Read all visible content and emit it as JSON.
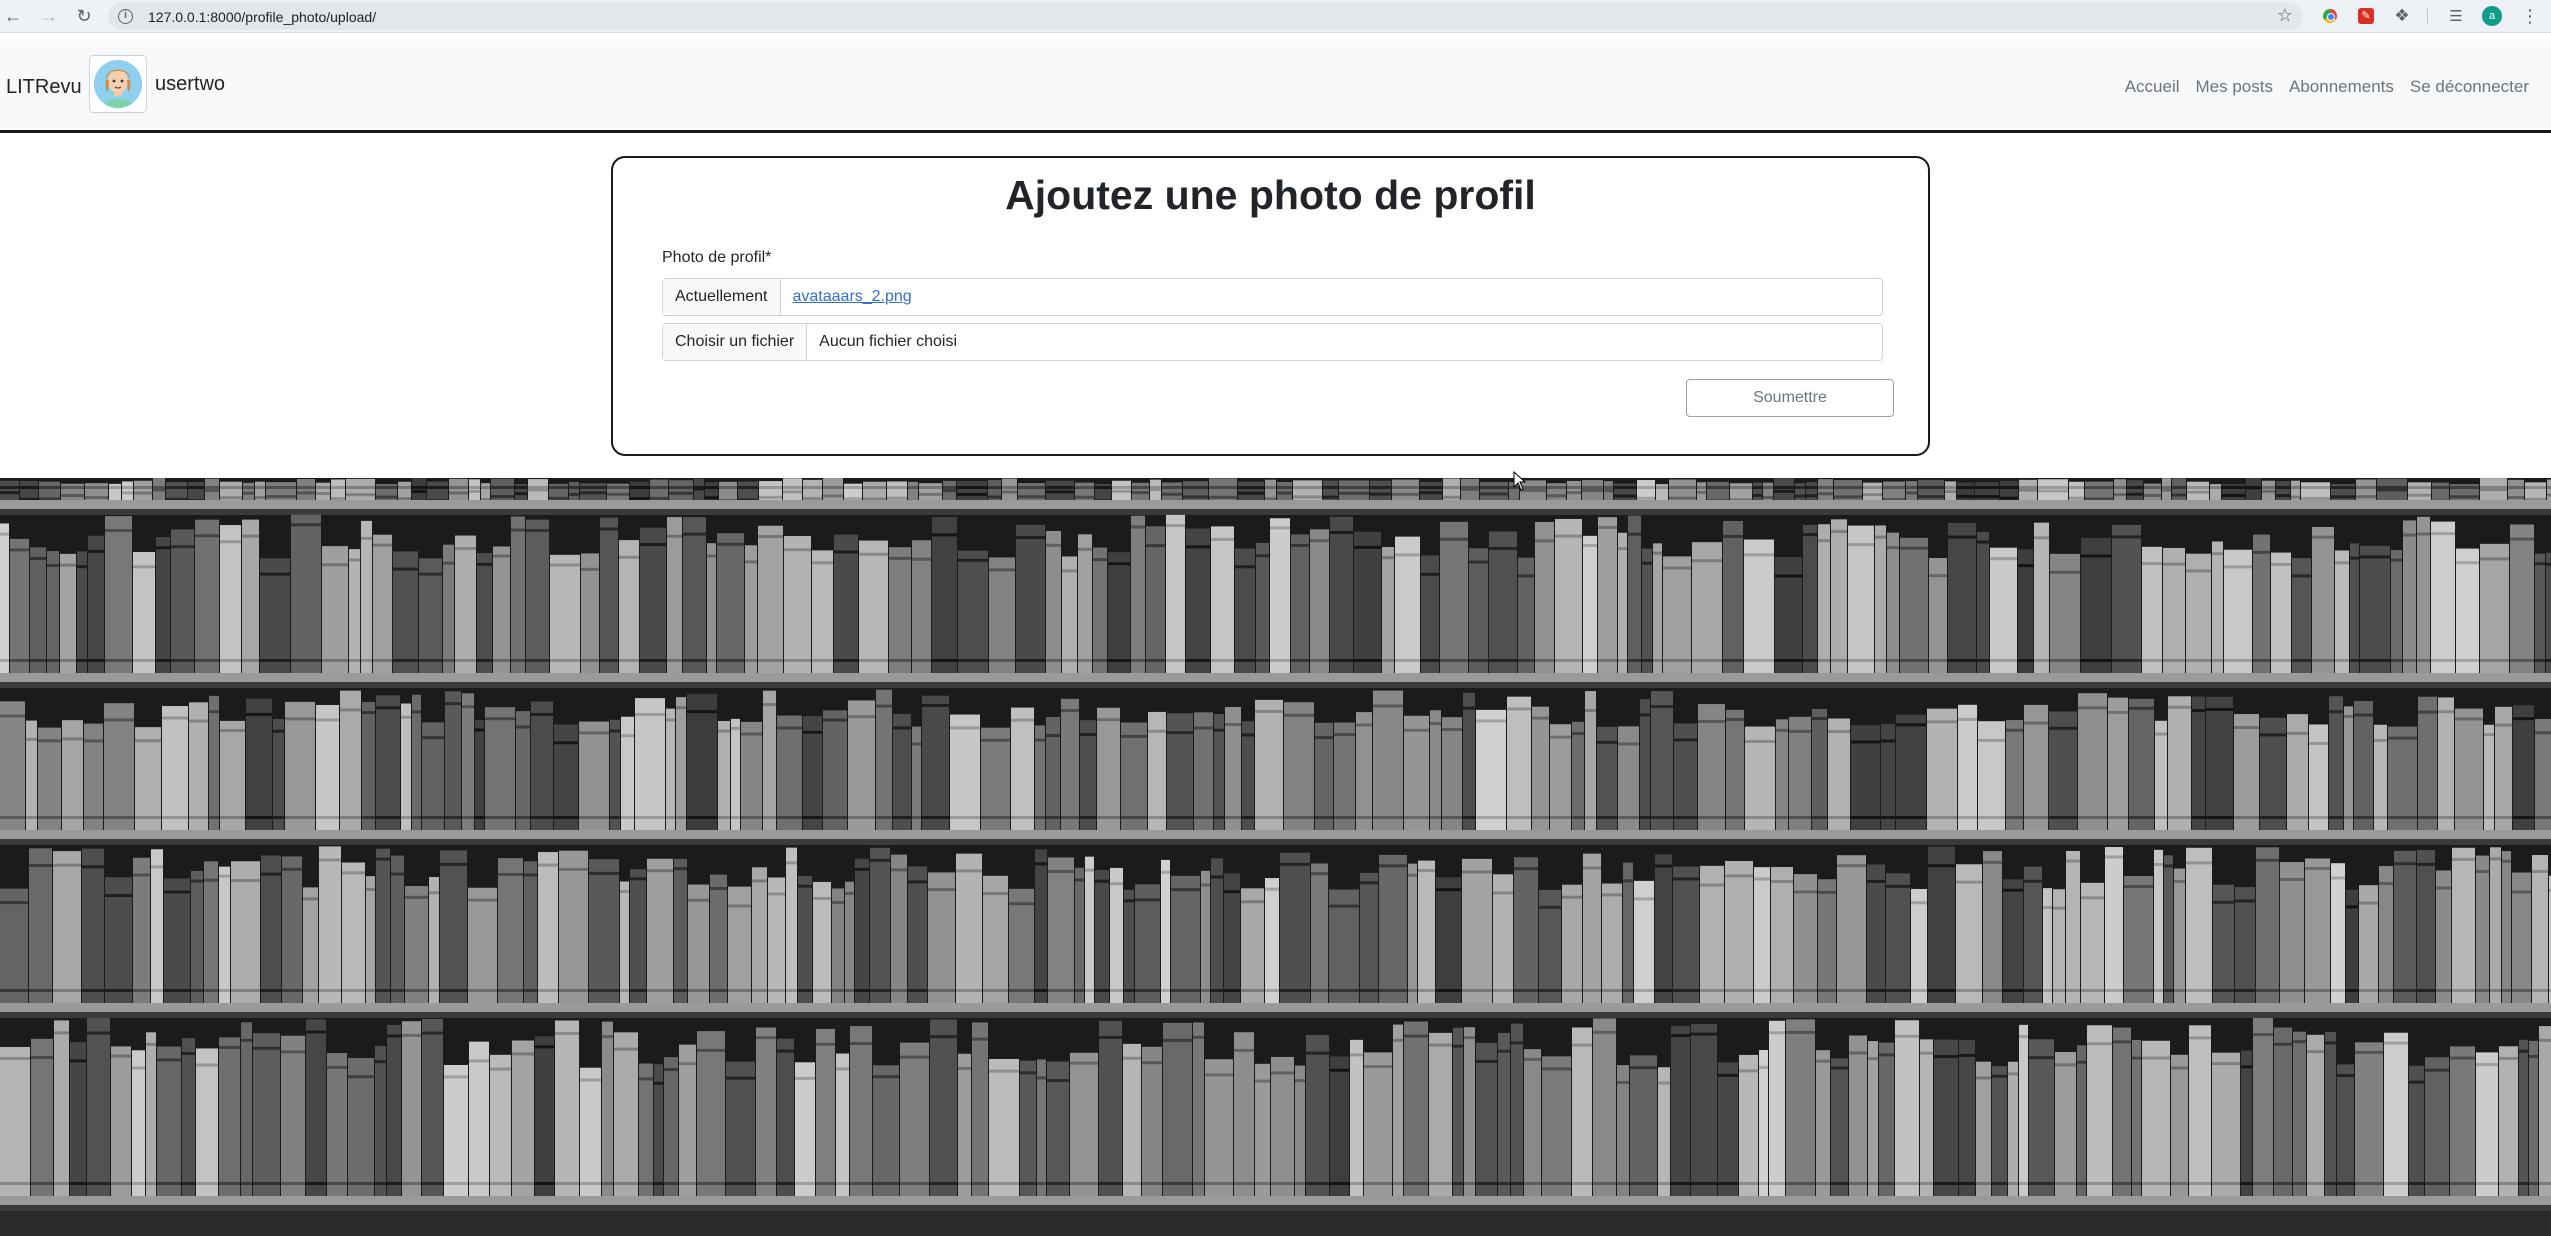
{
  "browser": {
    "url": "127.0.0.1:8000/profile_photo/upload/",
    "profile_initial": "a",
    "icons": [
      "back-icon",
      "forward-icon",
      "reload-icon",
      "info-icon",
      "star-icon",
      "chrome-extension-icon",
      "pdf-extension-icon",
      "puzzle-icon",
      "media-icon",
      "profile-avatar-icon",
      "menu-icon"
    ]
  },
  "header": {
    "brand": "LITRevu",
    "username": "usertwo",
    "nav": [
      "Accueil",
      "Mes posts",
      "Abonnements",
      "Se déconnecter"
    ]
  },
  "form": {
    "title": "Ajoutez une photo de profil",
    "label": "Photo de profil*",
    "current_label": "Actuellement",
    "current_file": "avataaars_2.png",
    "choose_label": "Choisir un fichier",
    "choose_value": "Aucun fichier choisi",
    "submit": "Soumettre"
  },
  "colors": {
    "accent_link": "#2f6fd6",
    "header_bg": "#f8f9fa",
    "border_dark": "#1a1a1a"
  }
}
